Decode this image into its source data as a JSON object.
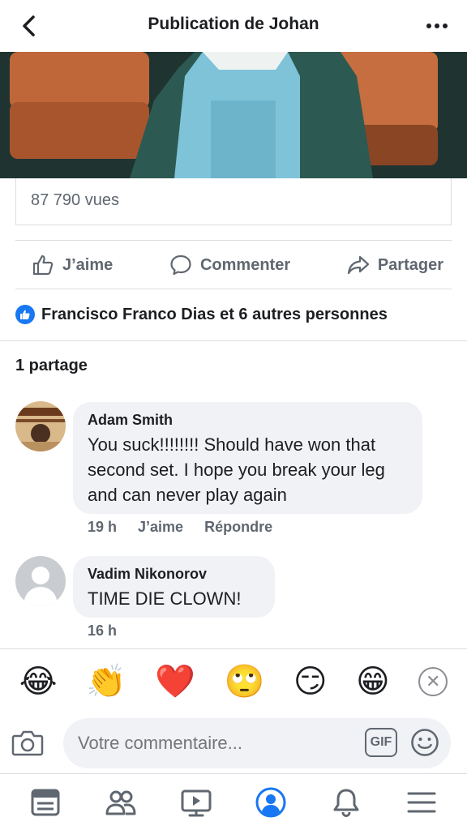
{
  "header": {
    "title": "Publication de Johan",
    "back_icon": "chevron-left-icon",
    "more_icon": "more-horizontal-icon"
  },
  "post": {
    "views": "87 790 vues",
    "actions": {
      "like": "J’aime",
      "comment": "Commenter",
      "share": "Partager"
    },
    "reactions_text": "Francisco Franco Dias et 6 autres personnes",
    "shares_text": "1 partage"
  },
  "comments": [
    {
      "author": "Adam Smith",
      "text": "You suck!!!!!!!!  Should have won that second set. I hope you break your leg and can never play again",
      "time": "19 h",
      "like": "J’aime",
      "reply": "Répondre"
    },
    {
      "author": "Vadim Nikonorov",
      "text": "TIME DIE CLOWN!",
      "time": "16 h"
    }
  ],
  "reactions_bar": [
    "😂",
    "👏",
    "❤️",
    "🙄",
    "😏",
    "😁"
  ],
  "composer": {
    "placeholder": "Votre commentaire...",
    "gif_label": "GIF"
  },
  "colors": {
    "accent": "#1877f2",
    "secondary_text": "#606770",
    "bubble": "#f0f2f5"
  }
}
